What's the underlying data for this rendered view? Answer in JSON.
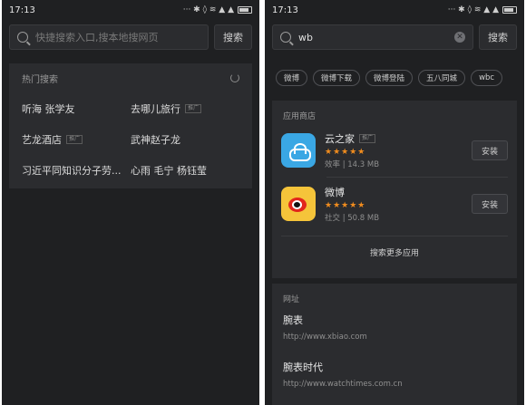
{
  "left": {
    "status": {
      "time": "17:13",
      "icons": "··· ✱ ◊ ≋ ▲ ▲"
    },
    "search": {
      "placeholder": "快捷搜索入口,搜本地搜网页",
      "button_label": "搜索"
    },
    "hot": {
      "title": "热门搜索",
      "items": [
        {
          "label": "听海 张学友",
          "ad": ""
        },
        {
          "label": "去哪儿旅行",
          "ad": "推广"
        },
        {
          "label": "艺龙酒店",
          "ad": "推广"
        },
        {
          "label": "武神赵子龙",
          "ad": ""
        },
        {
          "label": "习近平同知识分子劳...",
          "ad": ""
        },
        {
          "label": "心雨 毛宁 杨钰莹",
          "ad": ""
        }
      ]
    }
  },
  "right": {
    "status": {
      "time": "17:13",
      "icons": "··· ✱ ◊ ≋ ▲ ▲"
    },
    "search": {
      "value": "wb",
      "button_label": "搜索"
    },
    "chips": [
      "微博",
      "微博下载",
      "微博登陆",
      "五八同城",
      "wbc"
    ],
    "apps": {
      "title": "应用商店",
      "items": [
        {
          "name": "云之家",
          "ad": "推广",
          "stars": "★★★★★",
          "meta": "效率 | 14.3 MB",
          "install_label": "安装",
          "icon": "cloud-icon"
        },
        {
          "name": "微博",
          "ad": "",
          "stars": "★★★★★",
          "meta": "社交 | 50.8 MB",
          "install_label": "安装",
          "icon": "weibo-icon"
        }
      ],
      "more_label": "搜索更多应用"
    },
    "urls": {
      "title": "网址",
      "items": [
        {
          "title": "腕表",
          "link": "http://www.xbiao.com"
        },
        {
          "title": "腕表时代",
          "link": "http://www.watchtimes.com.cn"
        }
      ]
    }
  }
}
